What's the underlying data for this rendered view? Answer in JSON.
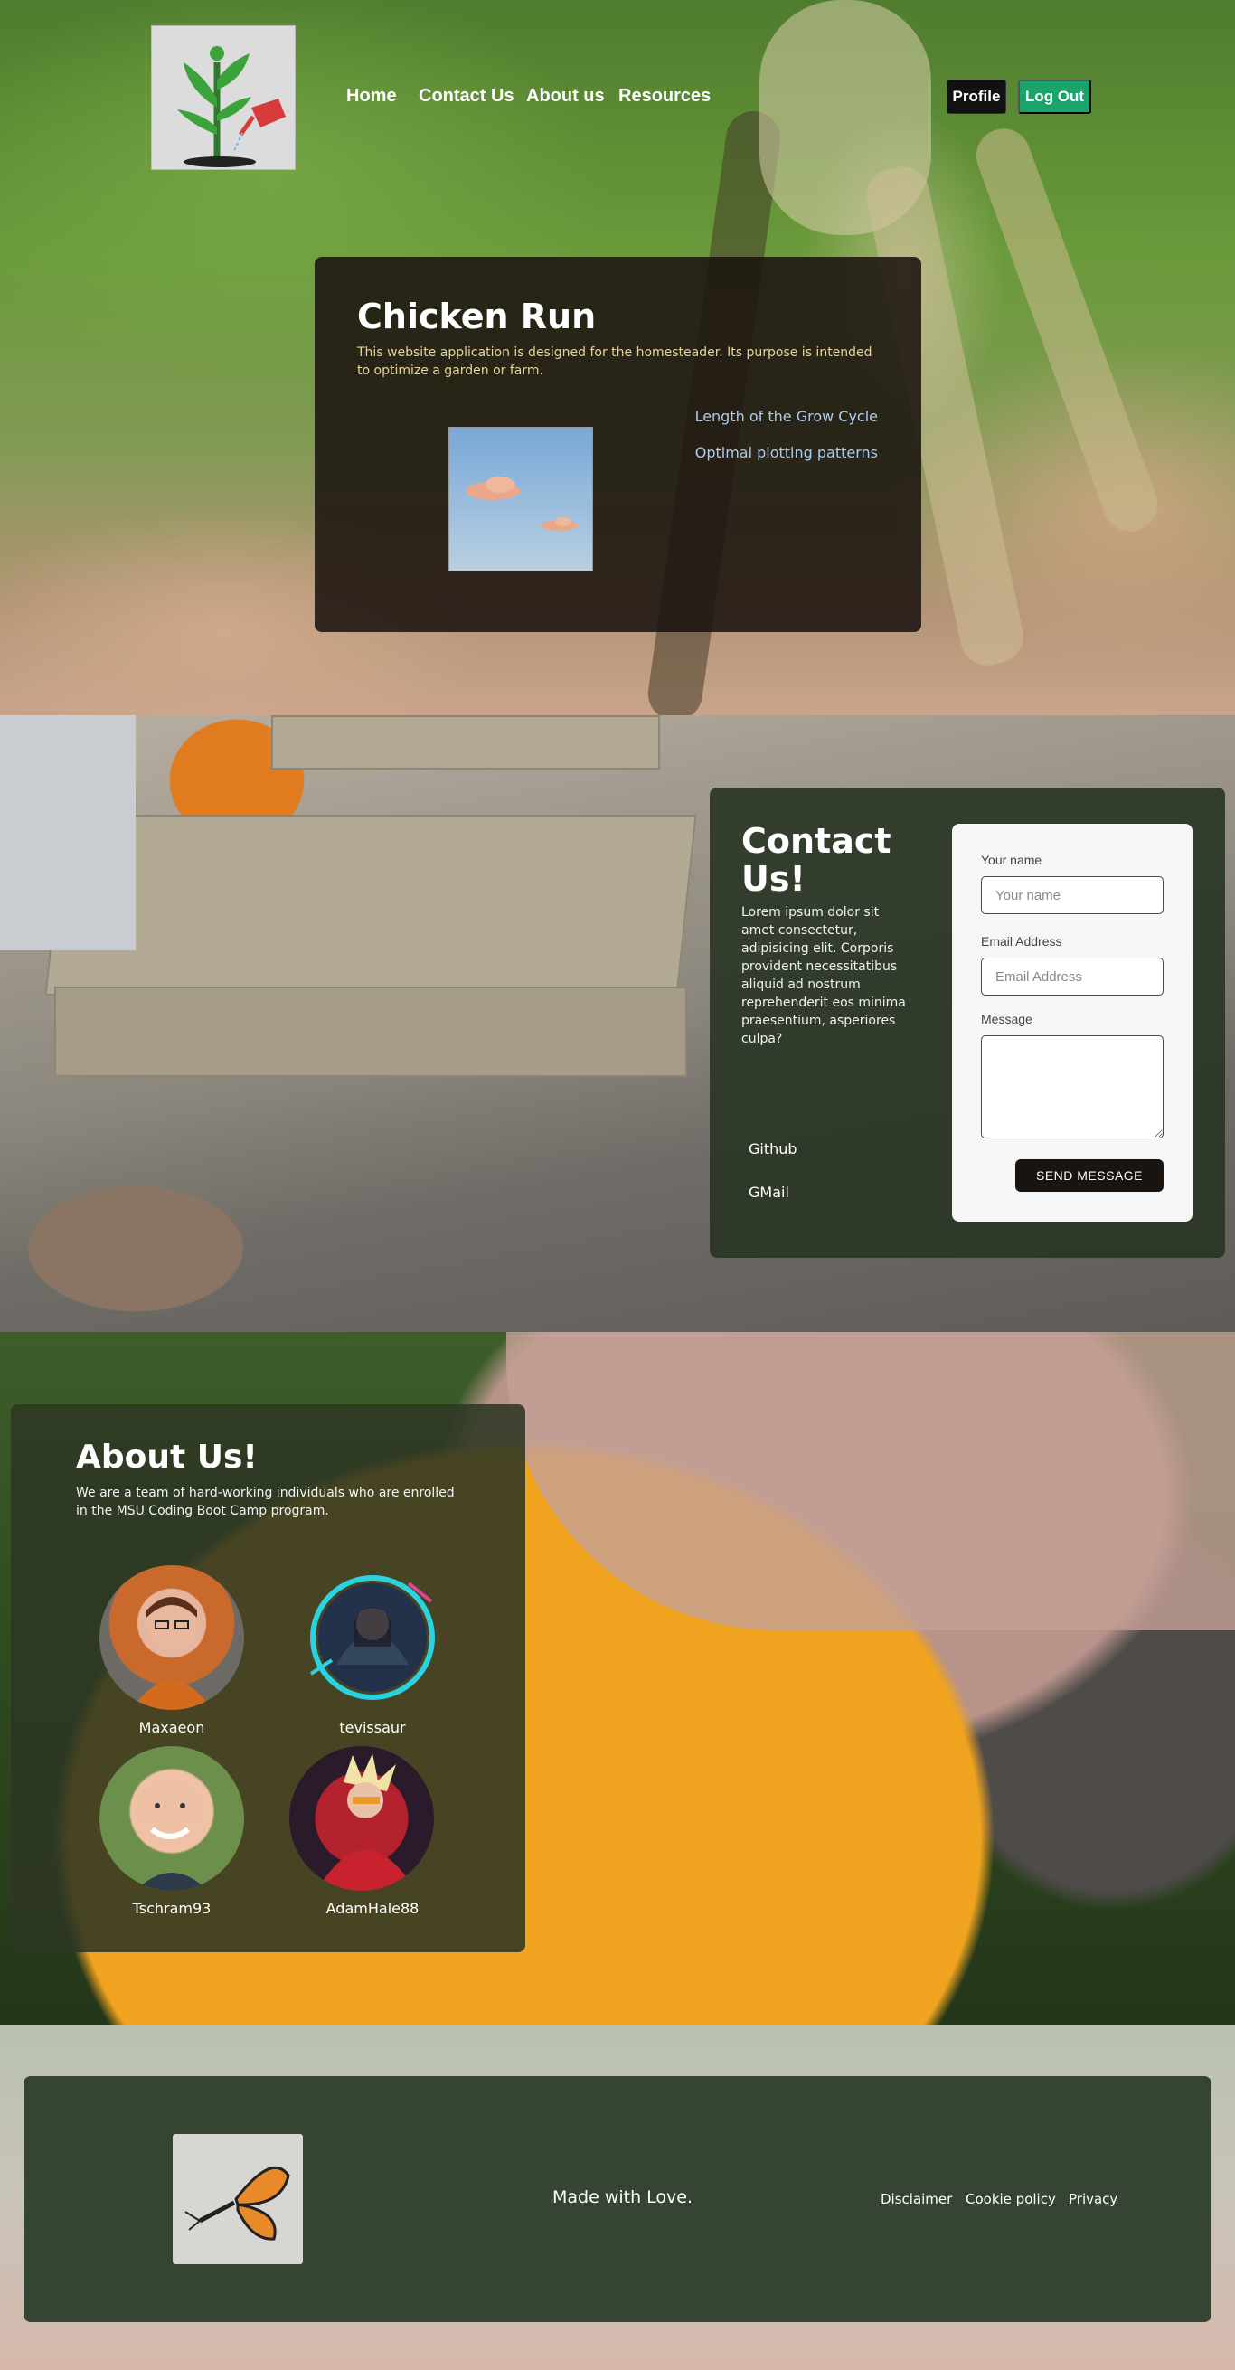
{
  "nav": {
    "links": [
      "Home",
      "Contact Us",
      "About us",
      "Resources"
    ],
    "profile_label": "Profile",
    "logout_label": "Log Out"
  },
  "hero": {
    "title": "Chicken Run",
    "description": "This website application is designed for the homesteader. Its purpose is intended to optimize a garden or farm.",
    "links": [
      "Length of the Grow Cycle",
      "Optimal plotting patterns"
    ]
  },
  "contact": {
    "title": "Contact Us!",
    "text": "Lorem ipsum dolor sit amet consectetur, adipisicing elit. Corporis provident necessitatibus aliquid ad nostrum reprehenderit eos minima praesentium, asperiores culpa?",
    "links": [
      "Github",
      "GMail"
    ],
    "form": {
      "name_label": "Your name",
      "name_placeholder": "Your name",
      "email_label": "Email Address",
      "email_placeholder": "Email Address",
      "message_label": "Message",
      "send_label": "SEND MESSAGE"
    }
  },
  "about": {
    "title": "About Us!",
    "description": "We are a team of hard-working individuals who are enrolled in the MSU Coding Boot Camp program.",
    "members": [
      "Maxaeon",
      "tevissaur",
      "Tschram93",
      "AdamHale88"
    ]
  },
  "footer": {
    "tagline": "Made with Love.",
    "links": [
      "Disclaimer",
      "Cookie policy",
      "Privacy"
    ]
  },
  "colors": {
    "logout_bg": "#1aa36a",
    "hero_desc": "#e8d49a",
    "hero_link": "#a9ccf0",
    "footer_card": "#364433"
  }
}
